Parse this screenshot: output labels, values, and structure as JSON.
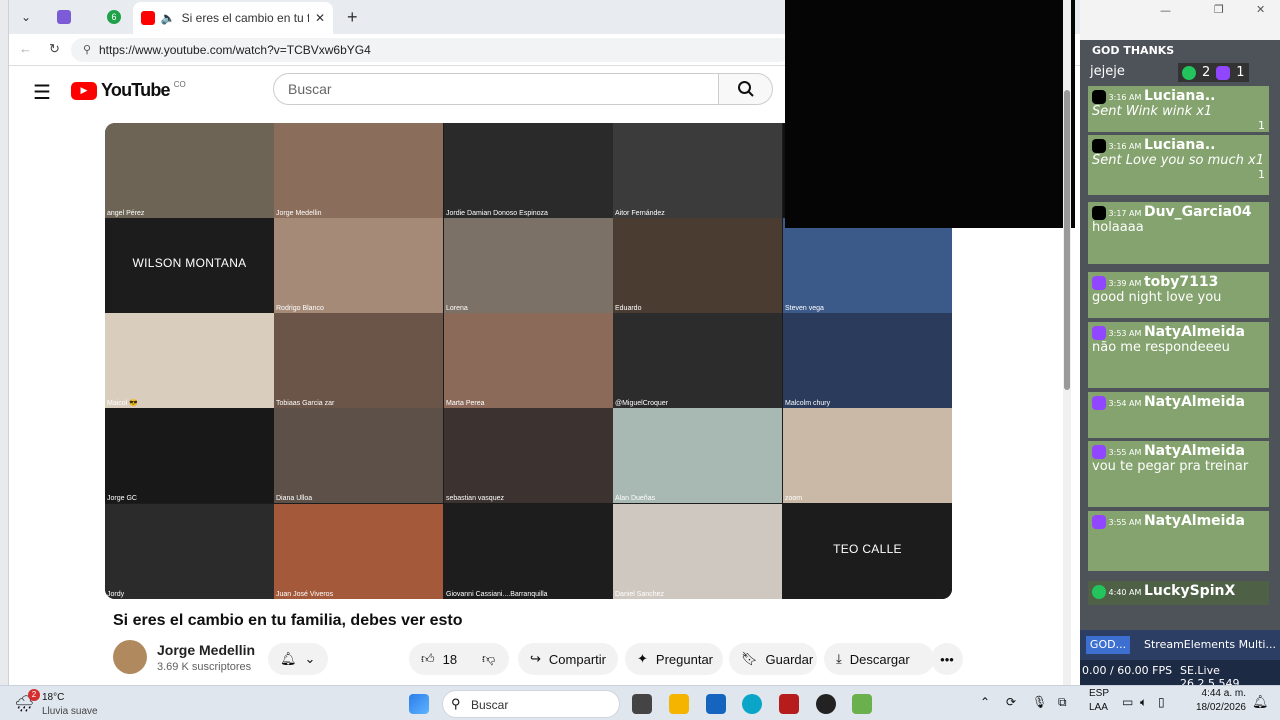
{
  "browser": {
    "tabs": [
      {
        "label": ""
      },
      {
        "label": ""
      },
      {
        "label": "6"
      },
      {
        "label": "Si eres el cambio en tu familia"
      }
    ],
    "new_tab": "+",
    "url": "https://www.youtube.com/watch?v=TCBVxw6bYG4"
  },
  "youtube": {
    "logo_text": "YouTube",
    "country": "CO",
    "search_placeholder": "Buscar",
    "video_title": "Si eres el cambio en tu familia, debes ver esto",
    "channel_name": "Jorge Medellin",
    "subscribers": "3.69 K suscriptores",
    "likes": "18",
    "share": "Compartir",
    "ask": "Preguntar",
    "save": "Guardar",
    "download": "Descargar",
    "participants": [
      "angel Pérez",
      "Jorge Medellin",
      "Jordie Damian Donoso Espinoza",
      "Aitor Fernández",
      "",
      "WILSON MONTANA",
      "Rodrigo Blanco",
      "Lorena",
      "Eduardo",
      "Steven vega",
      "Maicol 😎",
      "Tobiaas Garcia zar",
      "Marta Perea",
      "@MiguelCroquer",
      "Malcolm chury",
      "Jorge GC",
      "Diana Ulloa",
      "sebastian vasquez",
      "Alan Dueñas",
      "zoom",
      "Jordy",
      "Juan José Viveros",
      "Giovanni Cassiani....Barranquilla",
      "Daniel Sanchez",
      "TEO CALLE"
    ]
  },
  "chat": {
    "header": "GOD THANKS",
    "top_line": "jejeje",
    "counter_kick": "2",
    "counter_twitch": "1",
    "messages": [
      {
        "time": "3:16 AM",
        "user": "Luciana..",
        "text": "Sent Wink wink x1",
        "count": "1"
      },
      {
        "time": "3:16 AM",
        "user": "Luciana..",
        "text": "Sent Love you so much x1",
        "count": "1"
      },
      {
        "time": "3:17 AM",
        "user": "Duv_Garcia04",
        "text": "holaaaa"
      },
      {
        "time": "3:39 AM",
        "user": "toby7113",
        "text": "good night love you"
      },
      {
        "time": "3:53 AM",
        "user": "NatyAlmeida",
        "text": "não me respondeeeu"
      },
      {
        "time": "3:54 AM",
        "user": "NatyAlmeida",
        "text": ""
      },
      {
        "time": "3:55 AM",
        "user": "NatyAlmeida",
        "text": "vou te pegar pra treinar"
      },
      {
        "time": "3:55 AM",
        "user": "NatyAlmeida",
        "text": ""
      },
      {
        "time": "4:40 AM",
        "user": "LuckySpinX",
        "text": ""
      }
    ],
    "bottom_tabs": [
      "GOD...",
      "StreamElements Multi..."
    ],
    "fps": "0.00 / 60.00 FPS",
    "version": "SE.Live 26.2.5.549"
  },
  "taskbar": {
    "temp": "18°C",
    "weather": "Lluvia suave",
    "weather_badge": "2",
    "search": "Buscar",
    "lang1": "ESP",
    "lang2": "LAA",
    "time": "4:44 a. m.",
    "date": "18/02/2026"
  },
  "colors": {
    "yt_red": "#ff0000",
    "chat_green": "#84a36e",
    "twitch": "#9146ff",
    "kick": "#23c45b"
  }
}
